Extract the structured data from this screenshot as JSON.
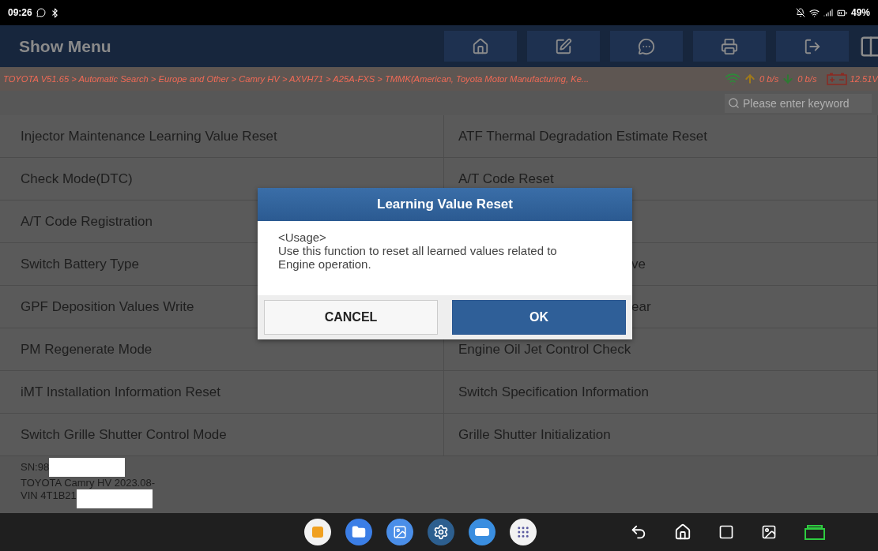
{
  "status_bar": {
    "time": "09:26",
    "battery": "49%"
  },
  "header": {
    "title": "Show Menu"
  },
  "breadcrumb": {
    "path": "TOYOTA V51.65 > Automatic Search > Europe and Other > Camry HV > AXVH71 > A25A-FXS > TMMK(American, Toyota Motor Manufacturing, Ke...",
    "upload": "0 b/s",
    "download": "0 b/s",
    "voltage": "12.51V"
  },
  "search": {
    "placeholder": "Please enter keyword"
  },
  "menu_rows": [
    {
      "left": {
        "label": "Injector Maintenance Learning Value Reset"
      },
      "right": {
        "label": "ATF Thermal Degradation Estimate Reset",
        "kind": "full"
      }
    },
    {
      "left": {
        "label": "Check Mode(DTC)"
      },
      "right": {
        "label": "A/T Code Reset",
        "kind": "full"
      }
    },
    {
      "left": {
        "label": "A/T Code Registration"
      },
      "right": {
        "kind": "hidden"
      }
    },
    {
      "left": {
        "label": "Switch Battery Type"
      },
      "right": {
        "label": "ve",
        "kind": "clipped"
      }
    },
    {
      "left": {
        "label": "GPF Deposition Values Write"
      },
      "right": {
        "label": "ear",
        "kind": "clipped"
      }
    },
    {
      "left": {
        "label": "PM Regenerate Mode"
      },
      "right": {
        "label": "Engine Oil Jet Control Check",
        "kind": "full"
      }
    },
    {
      "left": {
        "label": "iMT Installation Information Reset"
      },
      "right": {
        "label": "Switch Specification Information",
        "kind": "full"
      }
    },
    {
      "left": {
        "label": "Switch Grille Shutter Control Mode"
      },
      "right": {
        "label": "Grille Shutter Initialization",
        "kind": "full"
      }
    }
  ],
  "vehicle_info": {
    "serial": "SN:98",
    "model": "TOYOTA Camry HV 2023.08-",
    "vin": "VIN 4T1B21"
  },
  "dialog": {
    "title": "Learning Value Reset",
    "body": [
      "<Usage>",
      "Use this function to reset all learned values related to Engine operation."
    ],
    "buttons": [
      {
        "label": "CANCEL",
        "kind": "secondary"
      },
      {
        "label": "OK",
        "kind": "primary"
      }
    ]
  }
}
